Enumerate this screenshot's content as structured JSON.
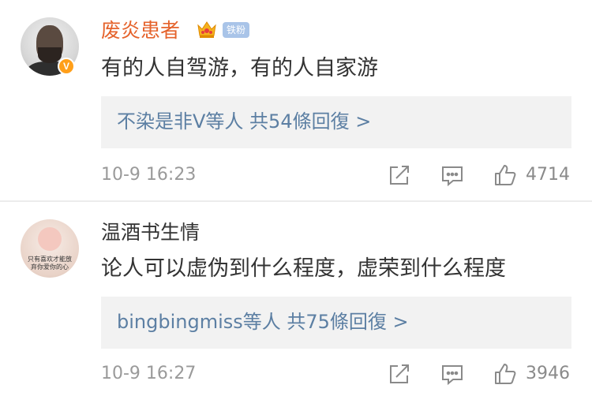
{
  "comments": [
    {
      "username": "废炎患者",
      "fan_badge": "铁粉",
      "content": "有的人自驾游，有的人自家游",
      "reply_summary": "不染是非V等人 共54條回復 >",
      "timestamp": "10-9 16:23",
      "likes": "4714",
      "avatar_badge": "V",
      "username_color": "#e5632c"
    },
    {
      "username": "温酒书生情",
      "content": "论人可以虚伪到什么程度，虚荣到什么程度",
      "reply_summary": "bingbingmiss等人 共75條回復 >",
      "timestamp": "10-9 16:27",
      "likes": "3946",
      "avatar_text": "只有喜欢才能放\n弃你爱你的心"
    }
  ],
  "colors": {
    "link": "#5c7fa3",
    "reply_bg": "#f2f2f2",
    "meta": "#9a9a9a"
  },
  "icons": [
    "share-icon",
    "comment-icon",
    "like-icon",
    "crown-icon"
  ]
}
